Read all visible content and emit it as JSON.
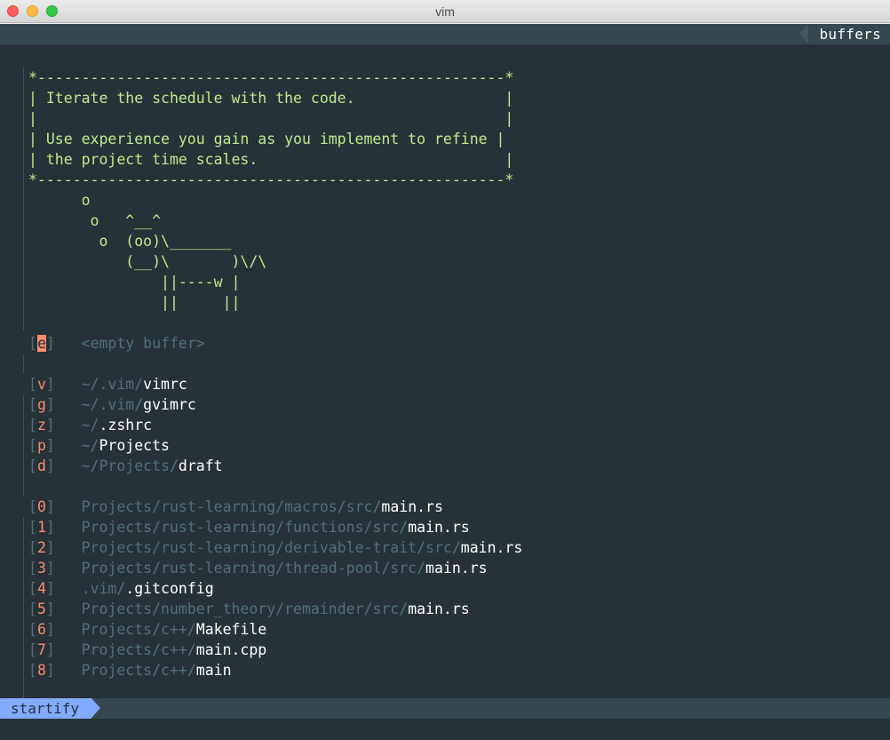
{
  "window": {
    "title": "vim"
  },
  "tabline": {
    "right_label": "buffers"
  },
  "header": {
    "box_lines": [
      "*-----------------------------------------------------*",
      "| Iterate the schedule with the code.                 |",
      "|                                                     |",
      "| Use experience you gain as you implement to refine |",
      "| the project time scales.                            |",
      "*-----------------------------------------------------*"
    ],
    "cow_lines": [
      "      o",
      "       o   ^__^",
      "        o  (oo)\\_______",
      "           (__)\\       )\\/\\",
      "               ||----w |",
      "               ||     ||"
    ]
  },
  "empty_buffer": {
    "key": "e",
    "label": "<empty buffer>"
  },
  "bookmarks": [
    {
      "key": "v",
      "dir": "~/.vim/",
      "name": "vimrc"
    },
    {
      "key": "g",
      "dir": "~/.vim/",
      "name": "gvimrc"
    },
    {
      "key": "z",
      "dir": "~/",
      "name": ".zshrc"
    },
    {
      "key": "p",
      "dir": "~/",
      "name": "Projects"
    },
    {
      "key": "d",
      "dir": "~/Projects/",
      "name": "draft"
    }
  ],
  "recent_files": [
    {
      "key": "0",
      "dir": "Projects/rust-learning/macros/src/",
      "name": "main.rs"
    },
    {
      "key": "1",
      "dir": "Projects/rust-learning/functions/src/",
      "name": "main.rs"
    },
    {
      "key": "2",
      "dir": "Projects/rust-learning/derivable-trait/src/",
      "name": "main.rs"
    },
    {
      "key": "3",
      "dir": "Projects/rust-learning/thread-pool/src/",
      "name": "main.rs"
    },
    {
      "key": "4",
      "dir": ".vim/",
      "name": ".gitconfig"
    },
    {
      "key": "5",
      "dir": "Projects/number_theory/remainder/src/",
      "name": "main.rs"
    },
    {
      "key": "6",
      "dir": "Projects/c++/",
      "name": "Makefile"
    },
    {
      "key": "7",
      "dir": "Projects/c++/",
      "name": "main.cpp"
    },
    {
      "key": "8",
      "dir": "Projects/c++/",
      "name": "main"
    }
  ],
  "statusline": {
    "mode": "startify"
  },
  "colors": {
    "background": "#263238",
    "bar": "#37474f",
    "accent": "#82aaff",
    "green": "#c3e88d",
    "orange": "#f78c6c",
    "dim": "#546e7a"
  }
}
